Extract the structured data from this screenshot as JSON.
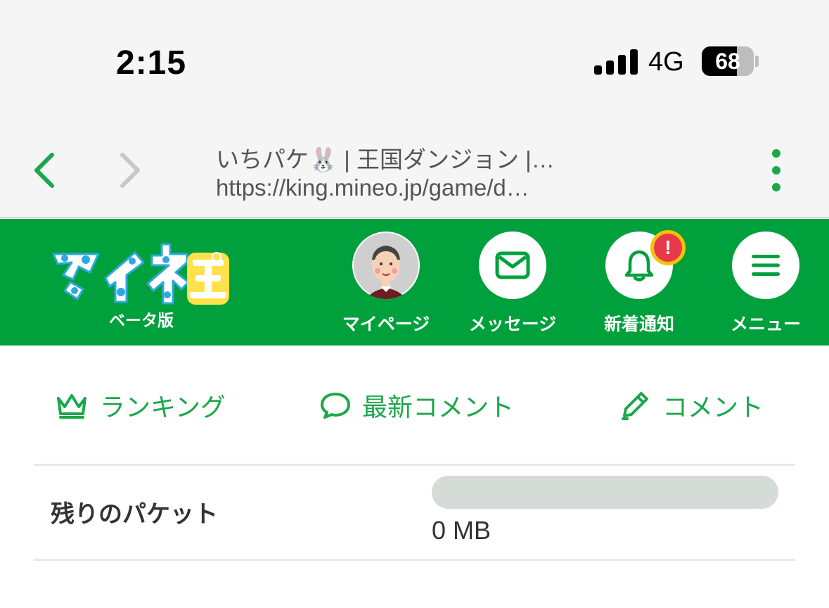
{
  "status_bar": {
    "time": "2:15",
    "network": "4G",
    "battery_level": "68",
    "battery_fraction": 0.68
  },
  "browser": {
    "page_title": "いちパケ🐰 | 王国ダンジョン |…",
    "url": "https://king.mineo.jp/game/d…",
    "back_icon": "chevron-left-icon",
    "forward_icon": "chevron-right-icon",
    "menu_icon": "vertical-dots-icon"
  },
  "header": {
    "logo_alt": "マイネ王",
    "logo_sub": "ベータ版",
    "buttons": [
      {
        "label": "マイページ",
        "icon": "avatar-icon"
      },
      {
        "label": "メッセージ",
        "icon": "envelope-icon"
      },
      {
        "label": "新着通知",
        "icon": "bell-icon"
      },
      {
        "label": "メニュー",
        "icon": "hamburger-icon"
      }
    ],
    "notification_badge": "!",
    "colors": {
      "brand": "#00a03c",
      "badge": "#e8394a",
      "badge_border": "#f3c20a"
    }
  },
  "tabs": [
    {
      "label": "ランキング",
      "icon": "crown-icon"
    },
    {
      "label": "最新コメント",
      "icon": "speech-bubble-icon"
    },
    {
      "label": "コメント",
      "icon": "pencil-icon"
    }
  ],
  "packet": {
    "label": "残りのパケット",
    "value": "0 MB",
    "remaining_fraction": 0
  }
}
